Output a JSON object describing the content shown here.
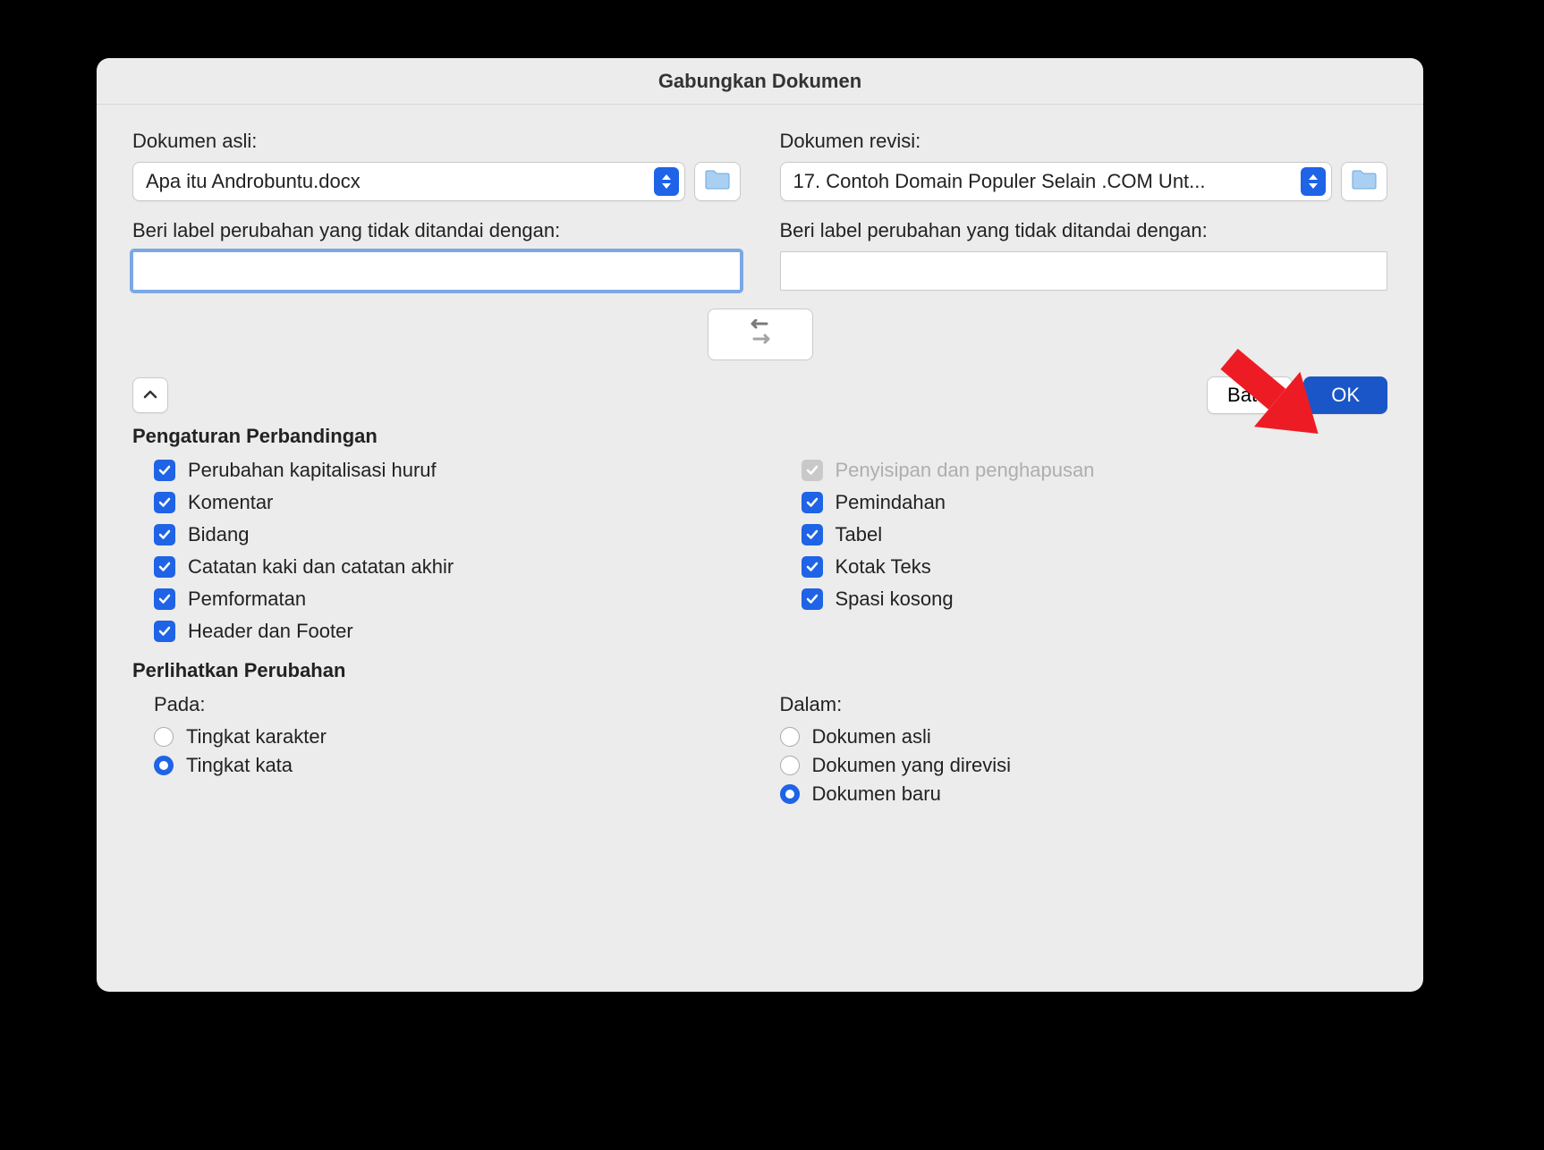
{
  "dialog": {
    "title": "Gabungkan Dokumen",
    "original": {
      "label": "Dokumen asli:",
      "file": "Apa itu Androbuntu.docx",
      "markLabel": "Beri label perubahan yang tidak ditandai dengan:",
      "markValue": ""
    },
    "revised": {
      "label": "Dokumen revisi:",
      "file": "17. Contoh Domain Populer Selain .COM Unt...",
      "markLabel": "Beri label perubahan yang tidak ditandai dengan:",
      "markValue": ""
    },
    "buttons": {
      "cancel": "Batal",
      "ok": "OK"
    },
    "comparison": {
      "title": "Pengaturan Perbandingan",
      "left": [
        "Perubahan kapitalisasi huruf",
        "Komentar",
        "Bidang",
        "Catatan kaki dan catatan akhir",
        "Pemformatan",
        "Header dan Footer"
      ],
      "right": [
        "Penyisipan dan penghapusan",
        "Pemindahan",
        "Tabel",
        "Kotak Teks",
        "Spasi kosong"
      ]
    },
    "showChanges": {
      "title": "Perlihatkan Perubahan",
      "atLabel": "Pada:",
      "atOptions": [
        "Tingkat karakter",
        "Tingkat kata"
      ],
      "inLabel": "Dalam:",
      "inOptions": [
        "Dokumen asli",
        "Dokumen yang direvisi",
        "Dokumen baru"
      ]
    }
  }
}
